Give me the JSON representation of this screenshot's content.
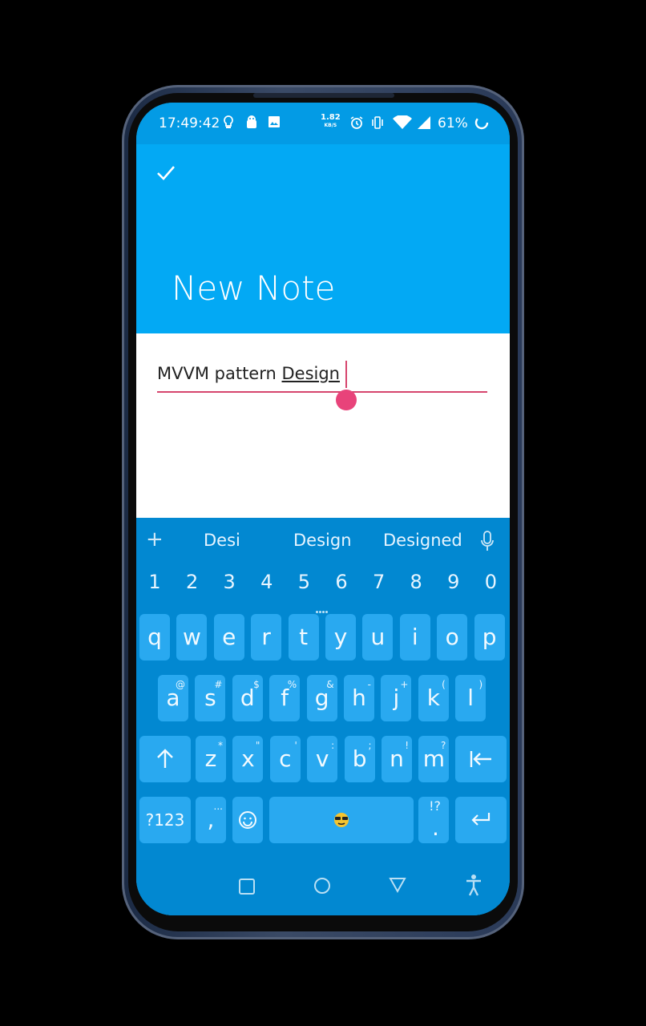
{
  "status_bar": {
    "time": "17:49:42",
    "net_speed_value": "1.82",
    "net_speed_unit": "KB/S",
    "battery_percent": "61%",
    "icons": [
      "lightbulb-icon",
      "android-icon",
      "image-icon",
      "alarm-icon",
      "vibrate-icon",
      "wifi-icon",
      "signal-icon",
      "battery-ring-icon"
    ]
  },
  "app_bar": {
    "confirm_icon": "check-icon",
    "title": "New Note"
  },
  "editor": {
    "text_before": "MVVM pattern ",
    "composing": "Design"
  },
  "keyboard": {
    "suggestions": [
      "Desi",
      "Design",
      "Designed"
    ],
    "numbers": [
      "1",
      "2",
      "3",
      "4",
      "5",
      "6",
      "7",
      "8",
      "9",
      "0"
    ],
    "row1": [
      "q",
      "w",
      "e",
      "r",
      "t",
      "y",
      "u",
      "i",
      "o",
      "p"
    ],
    "row2": [
      {
        "k": "a",
        "h": "@"
      },
      {
        "k": "s",
        "h": "#"
      },
      {
        "k": "d",
        "h": "$"
      },
      {
        "k": "f",
        "h": "%"
      },
      {
        "k": "g",
        "h": "&"
      },
      {
        "k": "h",
        "h": "-"
      },
      {
        "k": "j",
        "h": "+"
      },
      {
        "k": "k",
        "h": "("
      },
      {
        "k": "l",
        "h": ")"
      }
    ],
    "row3": [
      {
        "k": "z",
        "h": "*"
      },
      {
        "k": "x",
        "h": "\""
      },
      {
        "k": "c",
        "h": "'"
      },
      {
        "k": "v",
        "h": ":"
      },
      {
        "k": "b",
        "h": ";"
      },
      {
        "k": "n",
        "h": "!"
      },
      {
        "k": "m",
        "h": "?"
      }
    ],
    "symbols_label": "?123",
    "comma_label": ",",
    "comma_hint": "...",
    "period_label": ".",
    "period_hint": "!?"
  },
  "colors": {
    "primary": "#03a9f4",
    "primary_dark": "#039be5",
    "keyboard_bg": "#0288d1",
    "key_bg": "#29a9f0",
    "accent": "#e8437a"
  }
}
